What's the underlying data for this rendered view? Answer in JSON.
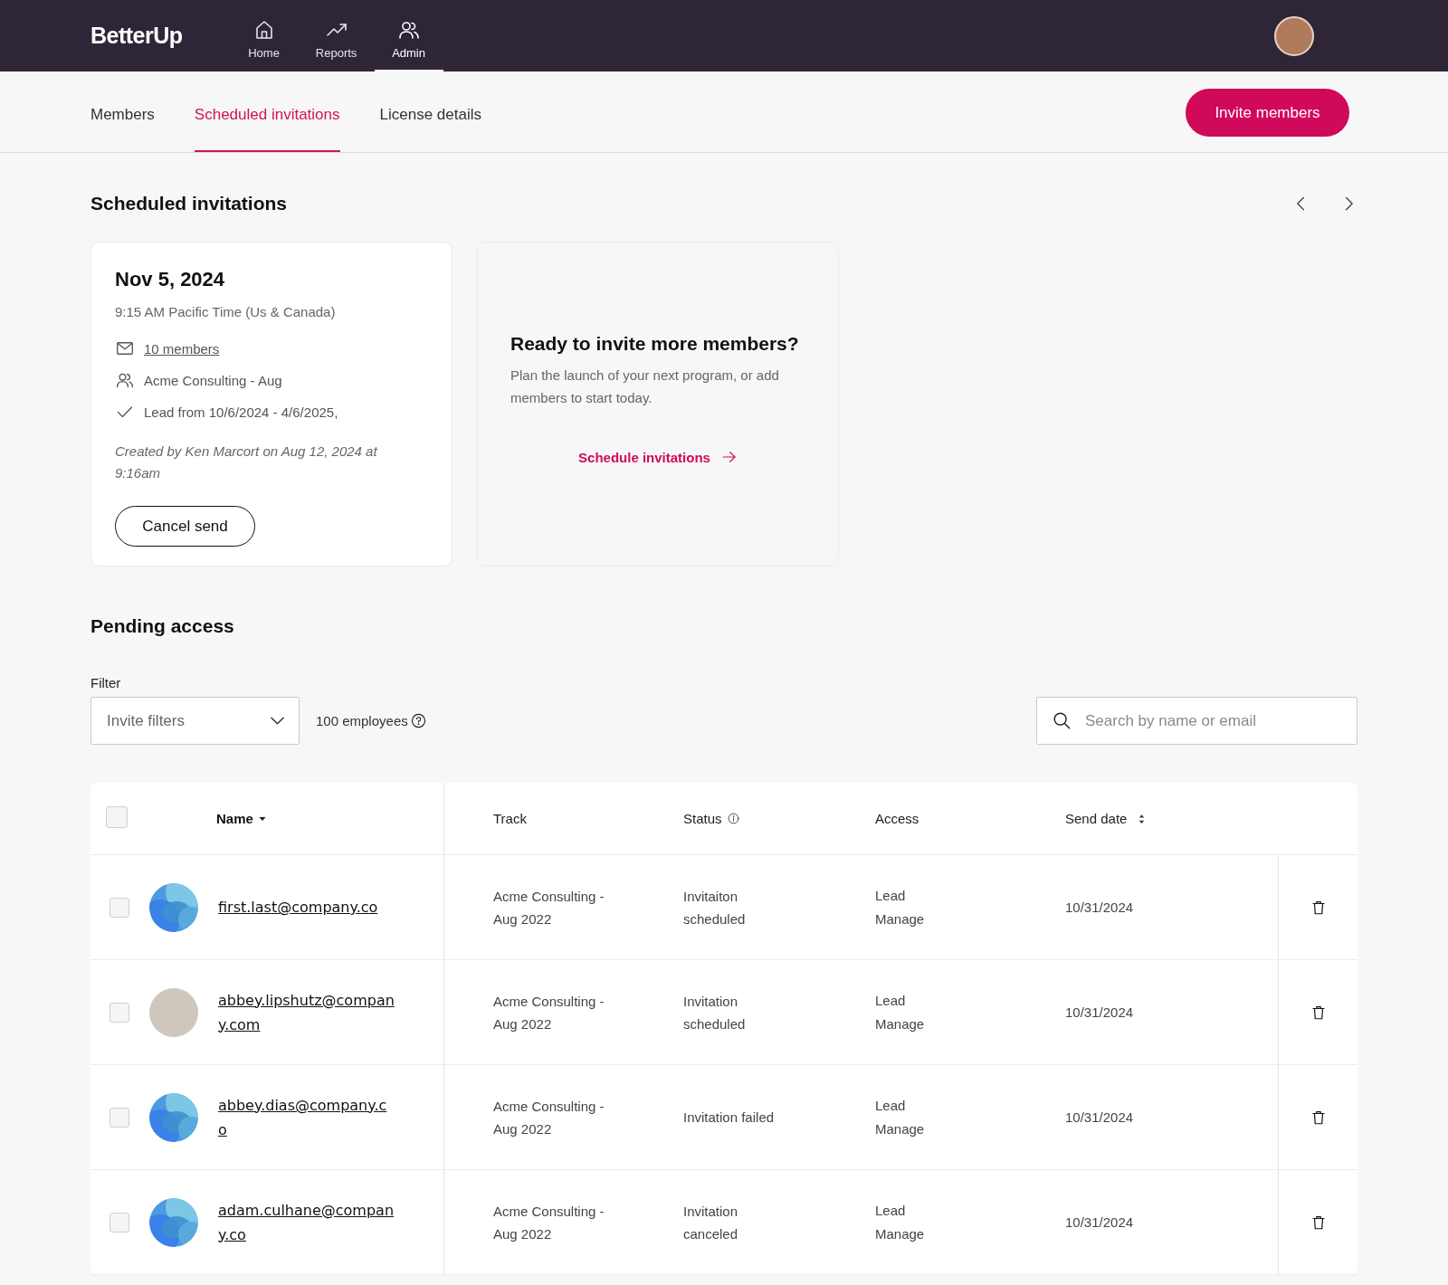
{
  "topbar": {
    "logo": "BetterUp",
    "nav": [
      {
        "label": "Home",
        "selected": false
      },
      {
        "label": "Reports",
        "selected": false
      },
      {
        "label": "Admin",
        "selected": true
      }
    ]
  },
  "tabs": [
    {
      "label": "Members",
      "selected": false
    },
    {
      "label": "Scheduled invitations",
      "selected": true
    },
    {
      "label": "License details",
      "selected": false
    }
  ],
  "invite_button": "Invite members",
  "scheduled": {
    "title": "Scheduled invitations",
    "card": {
      "date": "Nov 5, 2024",
      "time": "9:15 AM Pacific Time (Us & Canada)",
      "details": [
        {
          "kind": "link",
          "text": "10 members"
        },
        {
          "kind": "text",
          "text": "Acme Consulting - Aug"
        },
        {
          "kind": "text",
          "text": "Lead from 10/6/2024 - 4/6/2025,"
        }
      ],
      "created": "Created by Ken Marcort on Aug 12, 2024 at 9:16am",
      "cancel": "Cancel send"
    },
    "promo": {
      "title": "Ready to invite more members?",
      "text": "Plan the launch of your next program, or add members to start today.",
      "link": "Schedule invitations"
    }
  },
  "pending": {
    "title": "Pending access",
    "filter_label": "Filter",
    "filter_value": "Invite filters",
    "count": "100 employees",
    "search": {
      "placeholder": "Search by name or email"
    },
    "table": {
      "select_all": {
        "checked": false
      },
      "columns": [
        "Name",
        "Track",
        "Status",
        "Access",
        "Send date"
      ],
      "rows": [
        {
          "checked": false,
          "kind": "pattern",
          "email": "first.last@company.co",
          "track": "Acme Consulting - Aug 2022",
          "status": "Invitaiton scheduled",
          "access": [
            "Lead",
            "Manage"
          ],
          "send_date": "10/31/2024"
        },
        {
          "checked": false,
          "kind": "photo",
          "email": "abbey.lipshutz@company.com",
          "track": "Acme Consulting - Aug 2022",
          "status": "Invitation scheduled",
          "access": [
            "Lead",
            "Manage"
          ],
          "send_date": "10/31/2024"
        },
        {
          "checked": false,
          "kind": "pattern",
          "email": "abbey.dias@company.co",
          "track": "Acme Consulting - Aug 2022",
          "status": "Invitation failed",
          "access": [
            "Lead",
            "Manage"
          ],
          "send_date": "10/31/2024"
        },
        {
          "checked": false,
          "kind": "pattern",
          "email": "adam.culhane@company.co",
          "track": "Acme Consulting - Aug 2022",
          "status": "Invitation canceled",
          "access": [
            "Lead",
            "Manage"
          ],
          "send_date": "10/31/2024"
        }
      ]
    }
  }
}
